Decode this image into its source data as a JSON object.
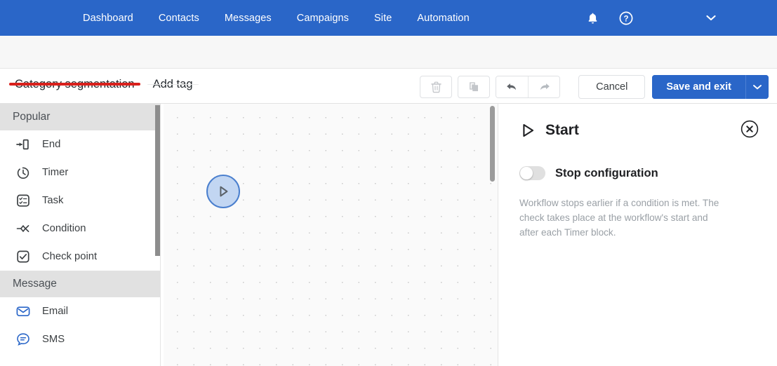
{
  "topnav": {
    "links": [
      {
        "label": "Dashboard"
      },
      {
        "label": "Contacts"
      },
      {
        "label": "Messages"
      },
      {
        "label": "Campaigns"
      },
      {
        "label": "Site"
      },
      {
        "label": "Automation"
      }
    ],
    "icons": {
      "notifications": "bell-icon",
      "help": "help-circle-icon",
      "account_menu": "chevron-down-icon"
    },
    "background_color": "#2a66c8"
  },
  "toolbar": {
    "tabs": [
      {
        "label": "Category segmentation",
        "active": true,
        "underline_color": "#d9201c"
      },
      {
        "label": "Add tag",
        "active": false,
        "underline_color": "#e8e8e8"
      }
    ],
    "actions": {
      "delete_icon": "trash-icon",
      "duplicate_icon": "copy-icon",
      "undo_icon": "undo-arrow-icon",
      "redo_icon": "redo-arrow-icon",
      "cancel_label": "Cancel",
      "save_label": "Save and exit",
      "save_caret_icon": "chevron-down-icon",
      "save_color": "#2a66c8"
    }
  },
  "sidebar": {
    "groups": [
      {
        "title": "Popular",
        "items": [
          {
            "label": "End",
            "icon": "end-block-icon",
            "color": "#3c4043"
          },
          {
            "label": "Timer",
            "icon": "timer-clock-icon",
            "color": "#3c4043"
          },
          {
            "label": "Task",
            "icon": "task-checklist-icon",
            "color": "#3c4043"
          },
          {
            "label": "Condition",
            "icon": "condition-branch-icon",
            "color": "#3c4043"
          },
          {
            "label": "Check point",
            "icon": "check-point-icon",
            "color": "#3c4043"
          }
        ]
      },
      {
        "title": "Message",
        "items": [
          {
            "label": "Email",
            "icon": "email-envelope-icon",
            "color": "#2a66c8"
          },
          {
            "label": "SMS",
            "icon": "sms-bubble-icon",
            "color": "#2a66c8"
          }
        ]
      }
    ],
    "scrollbar": {
      "name": "sidebar-scrollbar"
    }
  },
  "canvas": {
    "start_node": {
      "icon": "play-triangle-icon",
      "fill": "#c2d6f2",
      "border": "#4a7fce"
    },
    "scrollbar": {
      "name": "canvas-scrollbar"
    }
  },
  "right_panel": {
    "title": "Start",
    "title_icon": "play-triangle-icon",
    "close_icon": "close-circle-icon",
    "toggle": {
      "label": "Stop configuration",
      "state": "off"
    },
    "description": "Workflow stops earlier if a condition is met. The check takes place at the workflow's start and after each Timer block."
  }
}
